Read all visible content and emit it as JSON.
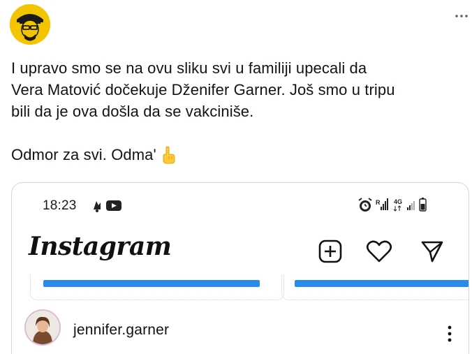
{
  "tweet": {
    "author_avatar": "user-avatar-yellow-illustration",
    "more_icon": "more-horizontal-icon",
    "text_lines": [
      "I upravo smo se na ovu sliku svi u familiji upecali da",
      "Vera Matović dočekuje Dženifer Garner. Još smo u tripu",
      "bili da je ova došla da se vakciniše."
    ],
    "text_line_last": "Odmor za svi. Odma'",
    "emoji": "pointing-up-emoji"
  },
  "embedded_screenshot": {
    "status_bar": {
      "time": "18:23",
      "left_icons": [
        "notification-icon",
        "youtube-icon"
      ],
      "right_icons": [
        "alarm-icon",
        "signal-icon",
        "4g-icon",
        "signal-weak-icon",
        "battery-icon"
      ],
      "network_label": "4G",
      "roaming_label": "R"
    },
    "app": {
      "logo_text": "Instagram",
      "actions": [
        "add-post-icon",
        "heart-icon",
        "send-icon"
      ]
    },
    "post": {
      "username": "jennifer.garner",
      "avatar": "profile-avatar",
      "more_icon": "more-vertical-icon"
    }
  },
  "colors": {
    "text": "#0f1419",
    "border": "#cfd9de",
    "instagram_blue": "#2a8cea",
    "avatar_ring": "#d9bdd0"
  }
}
